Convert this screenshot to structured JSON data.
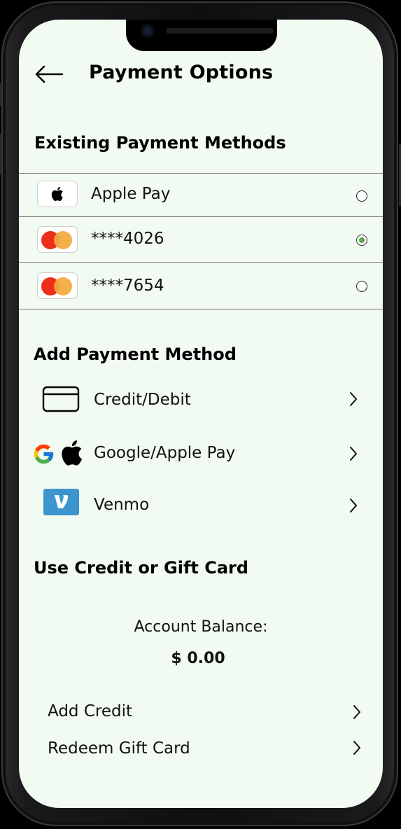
{
  "header": {
    "title": "Payment Options"
  },
  "existing": {
    "heading": "Existing Payment Methods",
    "methods": [
      {
        "label": "Apple Pay",
        "icon": "apple-logo-icon",
        "selected": false
      },
      {
        "label": "****4026",
        "icon": "mastercard-icon",
        "selected": true
      },
      {
        "label": "****7654",
        "icon": "mastercard-icon",
        "selected": false
      }
    ]
  },
  "add": {
    "heading": "Add Payment Method",
    "options": [
      {
        "label": "Credit/Debit",
        "icon": "credit-card-icon"
      },
      {
        "label": "Google/Apple Pay",
        "icon": "google-apple-icon"
      },
      {
        "label": "Venmo",
        "icon": "venmo-icon"
      }
    ]
  },
  "credit": {
    "heading": "Use Credit or Gift Card",
    "balance_label": "Account Balance:",
    "balance_value": "$ 0.00",
    "links": [
      {
        "label": "Add Credit"
      },
      {
        "label": "Redeem Gift Card"
      }
    ]
  },
  "colors": {
    "screen_bg": "#f2fbf1",
    "selected_radio": "#58a845",
    "mastercard_red": "#eb2f1a",
    "mastercard_yellow": "#f3a93b",
    "venmo_blue": "#3d95ce"
  }
}
